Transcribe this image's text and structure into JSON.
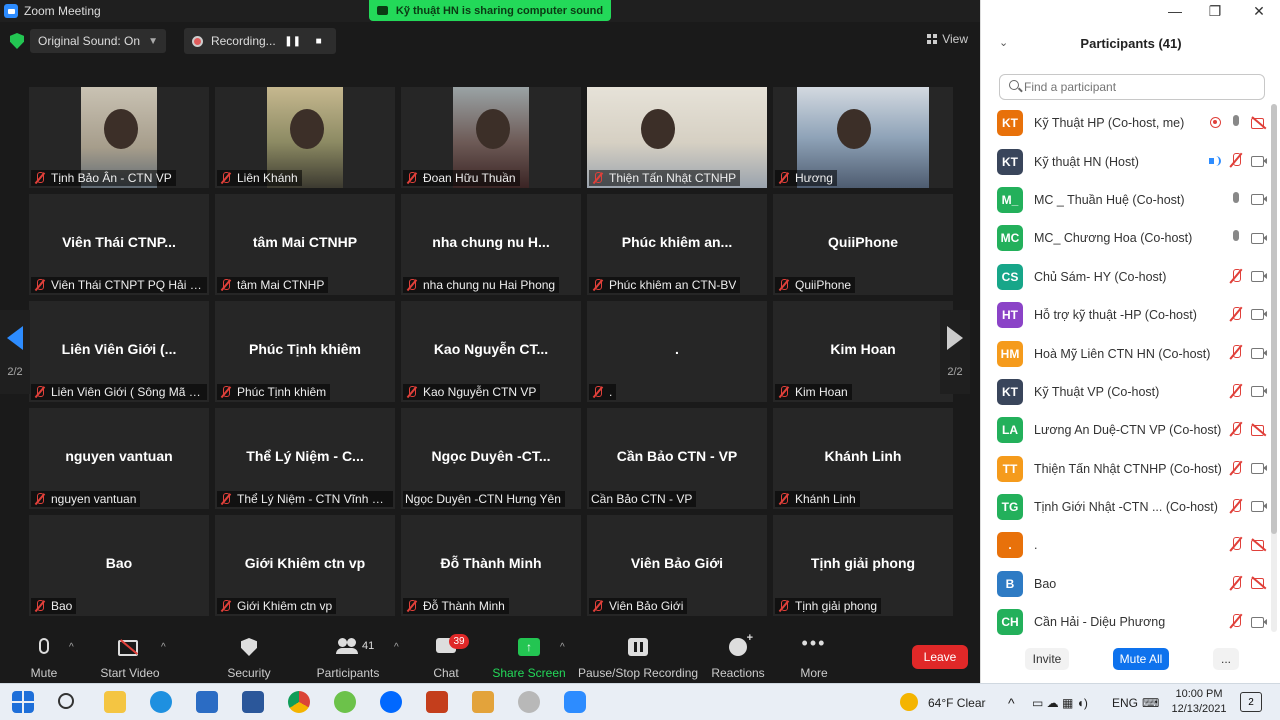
{
  "window": {
    "title": "Zoom Meeting"
  },
  "share_banner": {
    "text": "Kỹ thuật HN is sharing computer sound"
  },
  "topbar": {
    "original_sound": "Original Sound: On",
    "recording": "Recording...",
    "view": "View"
  },
  "gallery": {
    "page_left": "2/2",
    "page_right": "2/2",
    "tiles": [
      {
        "big": "",
        "label": "Tịnh Bảo Ân - CTN VP",
        "muted": true,
        "video": "v1"
      },
      {
        "big": "",
        "label": "Liên Khánh",
        "muted": true,
        "video": "v2"
      },
      {
        "big": "",
        "label": "Đoan Hữu Thuần",
        "muted": true,
        "video": "v3"
      },
      {
        "big": "",
        "label": "Thiện Tấn Nhật CTNHP",
        "muted": true,
        "video": "v4"
      },
      {
        "big": "",
        "label": "Hương",
        "muted": true,
        "video": "v5"
      },
      {
        "big": "Viên Thái CTNP...",
        "label": "Viên Thái CTNPT PQ Hải Ph...",
        "muted": true
      },
      {
        "big": "tâm Mai CTNHP",
        "label": "tâm Mai CTNHP",
        "muted": true
      },
      {
        "big": "nha chung nu H...",
        "label": "nha chung nu Hai Phong",
        "muted": true
      },
      {
        "big": "Phúc khiêm an...",
        "label": "Phúc khiêm an CTN-BV",
        "muted": true
      },
      {
        "big": "QuiiPhone",
        "label": "QuiiPhone",
        "muted": true
      },
      {
        "big": "Liên Viên Giới (...",
        "label": "Liên Viên Giới ( Sông Mã S...",
        "muted": true
      },
      {
        "big": "Phúc Tịnh khiêm",
        "label": "Phúc Tịnh khiêm",
        "muted": true
      },
      {
        "big": "Kao Nguyễn CT...",
        "label": "Kao Nguyễn CTN VP",
        "muted": true
      },
      {
        "big": ".",
        "label": ".",
        "muted": true
      },
      {
        "big": "Kim Hoan",
        "label": "Kim Hoan",
        "muted": true
      },
      {
        "big": "nguyen vantuan",
        "label": "nguyen vantuan",
        "muted": true
      },
      {
        "big": "Thể Lý Niệm - C...",
        "label": "Thể Lý Niệm - CTN Vĩnh Ph...",
        "muted": true
      },
      {
        "big": "Ngọc Duyên -CT...",
        "label": "Ngọc Duyên -CTN Hưng Yên",
        "muted": false
      },
      {
        "big": "Cần Bảo CTN - VP",
        "label": "Cần Bảo CTN - VP",
        "muted": false
      },
      {
        "big": "Khánh Linh",
        "label": "Khánh Linh",
        "muted": true
      },
      {
        "big": "Bao",
        "label": "Bao",
        "muted": true
      },
      {
        "big": "Giới Khiêm ctn vp",
        "label": "Giới Khiêm ctn vp",
        "muted": true
      },
      {
        "big": "Đỗ Thành Minh",
        "label": "Đỗ Thành Minh",
        "muted": true
      },
      {
        "big": "Viên Bảo Giới",
        "label": "Viên Bảo Giới",
        "muted": true
      },
      {
        "big": "Tịnh giải phong",
        "label": "Tịnh giải phong",
        "muted": true
      }
    ]
  },
  "toolbar": {
    "mute": "Mute",
    "start_video": "Start Video",
    "security": "Security",
    "participants": "Participants",
    "participants_count": "41",
    "chat": "Chat",
    "chat_badge": "39",
    "share_screen": "Share Screen",
    "pause_recording": "Pause/Stop Recording",
    "reactions": "Reactions",
    "more": "More",
    "leave": "Leave"
  },
  "panel": {
    "title": "Participants (41)",
    "search_placeholder": "Find a participant",
    "invite": "Invite",
    "mute_all": "Mute All",
    "more": "...",
    "participants": [
      {
        "initials": "KT",
        "color": "#e8710a",
        "name": "Kỹ Thuật HP (Co-host, me)",
        "rec": true,
        "mic": "on",
        "video": "off"
      },
      {
        "initials": "KT",
        "color": "#39455b",
        "name": "Kỹ thuật HN (Host)",
        "speaking": true,
        "mic": "off",
        "video": "on"
      },
      {
        "initials": "M_",
        "color": "#23b05b",
        "name": "MC _ Thuần Huệ (Co-host)",
        "mic": "on",
        "video": "on"
      },
      {
        "initials": "MC",
        "color": "#23b05b",
        "name": "MC_ Chương Hoa (Co-host)",
        "mic": "on",
        "video": "on"
      },
      {
        "initials": "CS",
        "color": "#17a689",
        "name": "Chủ Sám- HY (Co-host)",
        "mic": "off",
        "video": "on"
      },
      {
        "initials": "HT",
        "color": "#8b43c7",
        "name": "Hỗ trợ kỹ thuật -HP (Co-host)",
        "mic": "off",
        "video": "on"
      },
      {
        "initials": "HM",
        "color": "#f59b1c",
        "name": "Hoà Mỹ Liên CTN HN (Co-host)",
        "mic": "off",
        "video": "on"
      },
      {
        "initials": "KT",
        "color": "#39455b",
        "name": "Kỹ Thuật VP (Co-host)",
        "mic": "off",
        "video": "on"
      },
      {
        "initials": "LA",
        "color": "#23b05b",
        "name": "Lương An Duệ-CTN VP (Co-host)",
        "mic": "off",
        "video": "off"
      },
      {
        "initials": "TT",
        "color": "#f59b1c",
        "name": "Thiện Tấn Nhật CTNHP (Co-host)",
        "mic": "off",
        "video": "on"
      },
      {
        "initials": "TG",
        "color": "#23b05b",
        "name": "Tịnh Giới Nhật -CTN ...   (Co-host)",
        "mic": "off",
        "video": "on"
      },
      {
        "initials": ".",
        "color": "#e8710a",
        "name": ".",
        "mic": "off",
        "video": "off"
      },
      {
        "initials": "B",
        "color": "#2e7bc4",
        "name": "Bao",
        "mic": "off",
        "video": "off"
      },
      {
        "initials": "CH",
        "color": "#23b05b",
        "name": "Cần Hải - Diệu Phương",
        "mic": "off",
        "video": "on"
      }
    ]
  },
  "taskbar": {
    "weather": "64°F  Clear",
    "lang": "ENG",
    "time": "10:00 PM",
    "date": "12/13/2021",
    "notifications": "2"
  }
}
